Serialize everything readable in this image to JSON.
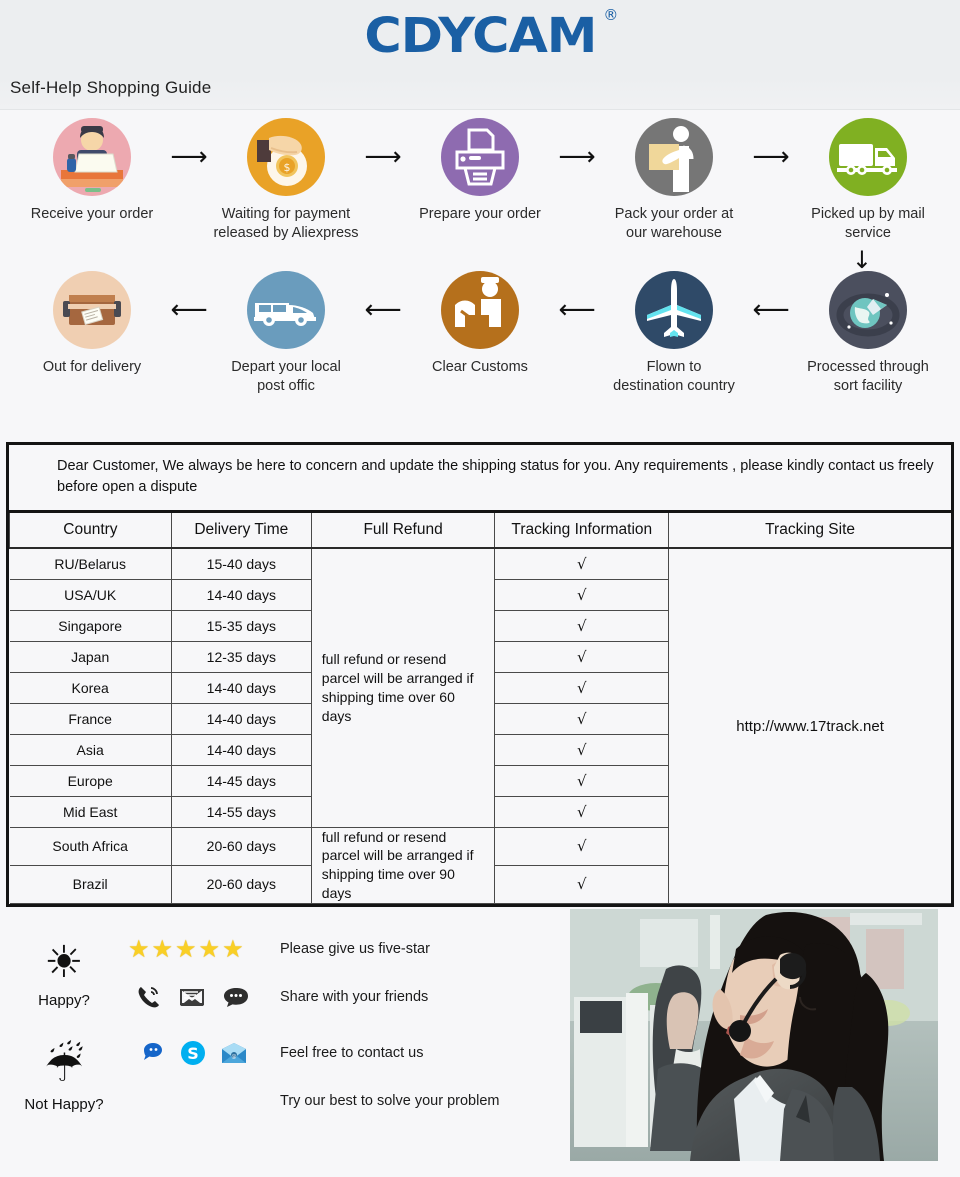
{
  "header": {
    "logo_text": "CDYCAM",
    "logo_registered_mark": "®",
    "logo_color": "#1a5fa4",
    "guide_title": "Self-Help Shopping Guide"
  },
  "flow": {
    "arrow_right": "⟶",
    "arrow_left": "⟵",
    "arrow_down": "↓",
    "row1": [
      {
        "icon": "person-at-desk-icon",
        "bg": "#eda9b0",
        "caption": "Receive your order"
      },
      {
        "icon": "hand-holding-money-bag-icon",
        "bg": "#e9a227",
        "caption": "Waiting for payment\nreleased by Aliexpress"
      },
      {
        "icon": "printer-icon",
        "bg": "#8e6bb0",
        "caption": "Prepare your order"
      },
      {
        "icon": "warehouse-worker-box-icon",
        "bg": "#767676",
        "caption": "Pack your order at\nour warehouse"
      },
      {
        "icon": "mail-truck-icon",
        "bg": "#80b022",
        "caption": "Picked up by mail service"
      }
    ],
    "row2": [
      {
        "icon": "parcel-box-icon",
        "bg": "#f0cfb2",
        "caption": "Out for delivery"
      },
      {
        "icon": "delivery-van-icon",
        "bg": "#6a9cbd",
        "caption": "Depart your local\npost offic"
      },
      {
        "icon": "customs-officer-icon",
        "bg": "#b5701c",
        "caption": "Clear  Customs"
      },
      {
        "icon": "airplane-icon",
        "bg": "#2f4a68",
        "caption": "Flown to\ndestination country"
      },
      {
        "icon": "global-sort-facility-icon",
        "bg": "#4b4f5e",
        "caption": "Processed through\nsort facility"
      }
    ]
  },
  "table": {
    "notice": "Dear Customer, We always be here to concern and update the shipping status for you.  Any requirements , please kindly contact us freely before open a dispute",
    "columns": [
      "Country",
      "Delivery Time",
      "Full Refund",
      "Tracking Information",
      "Tracking Site"
    ],
    "check_mark": "√",
    "refund_groups": [
      {
        "text": "full refund or resend parcel will be arranged if shipping time over 60 days",
        "rowspan": 9
      },
      {
        "text": "full refund or resend parcel will be arranged if shipping time over 90 days",
        "rowspan": 2
      }
    ],
    "tracking_site": "http://www.17track.net",
    "rows": [
      {
        "country": "RU/Belarus",
        "delivery_time": "15-40 days",
        "tracking": "√"
      },
      {
        "country": "USA/UK",
        "delivery_time": "14-40 days",
        "tracking": "√"
      },
      {
        "country": "Singapore",
        "delivery_time": "15-35 days",
        "tracking": "√"
      },
      {
        "country": "Japan",
        "delivery_time": "12-35 days",
        "tracking": "√"
      },
      {
        "country": "Korea",
        "delivery_time": "14-40 days",
        "tracking": "√"
      },
      {
        "country": "France",
        "delivery_time": "14-40 days",
        "tracking": "√"
      },
      {
        "country": "Asia",
        "delivery_time": "14-40 days",
        "tracking": "√"
      },
      {
        "country": "Europe",
        "delivery_time": "14-45 days",
        "tracking": "√"
      },
      {
        "country": "Mid East",
        "delivery_time": "14-55 days",
        "tracking": "√"
      },
      {
        "country": "South Africa",
        "delivery_time": "20-60 days",
        "tracking": "√"
      },
      {
        "country": "Brazil",
        "delivery_time": "20-60 days",
        "tracking": "√"
      }
    ]
  },
  "service": {
    "happy_label": "Happy?",
    "happy_icon": "sun-icon",
    "not_happy_label": "Not Happy?",
    "not_happy_icon": "rain-cloud-icon",
    "stars": "★★★★★",
    "star_count": 5,
    "star_color": "#f9cf26",
    "five_star_text": "Please give us five-star",
    "share_text": "Share with your friends",
    "contact_text": "Feel free to contact us",
    "solve_text": "Try our best to solve your problem",
    "share_icons": [
      "phone-ring-icon",
      "envelope-icon",
      "speech-bubble-icon"
    ],
    "contact_icons": [
      "aliexpress-message-icon",
      "skype-icon",
      "email-envelope-icon"
    ],
    "skype_letter": "S",
    "skype_color": "#00aff0",
    "aliim_color": "#1565c9",
    "photo_alt": "call-center-agent-photo"
  }
}
